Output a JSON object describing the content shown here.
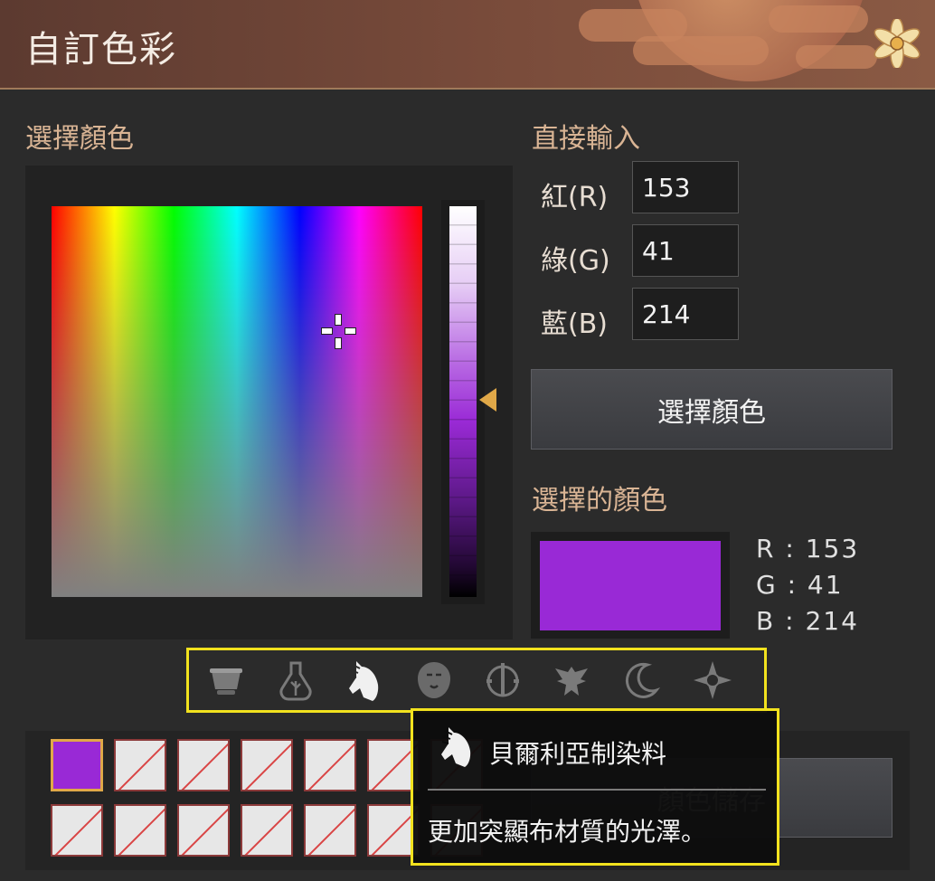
{
  "window": {
    "title": "自訂色彩",
    "close_icon": "flower-close-icon"
  },
  "picker": {
    "section_label": "選擇顏色"
  },
  "direct_input": {
    "section_label": "直接輸入",
    "red_label": "紅(R)",
    "green_label": "綠(G)",
    "blue_label": "藍(B)",
    "red_value": "153",
    "green_value": "41",
    "blue_value": "214",
    "select_button_label": "選擇顏色"
  },
  "selected": {
    "section_label": "選擇的顏色",
    "color": "#9929d6",
    "r_readout": "R : 153",
    "g_readout": "G : 41",
    "b_readout": "B : 214"
  },
  "dyes": [
    {
      "icon": "cauldron-icon",
      "active": false
    },
    {
      "icon": "flask-icon",
      "active": false
    },
    {
      "icon": "horse-head-icon",
      "active": true
    },
    {
      "icon": "lion-head-icon",
      "active": false
    },
    {
      "icon": "dial-icon",
      "active": false
    },
    {
      "icon": "eagle-icon",
      "active": false
    },
    {
      "icon": "crescent-moon-icon",
      "active": false
    },
    {
      "icon": "compass-star-icon",
      "active": false
    }
  ],
  "saved": {
    "button_label": "顏色儲存",
    "filled_slot_color": "#9929d6"
  },
  "tooltip": {
    "icon": "horse-head-icon",
    "title": "貝爾利亞制染料",
    "description": "更加突顯布材質的光澤。"
  },
  "colors": {
    "accent_gold": "#e0a848",
    "highlight_yellow": "#f2e21e",
    "label_tan": "#d9b494"
  }
}
